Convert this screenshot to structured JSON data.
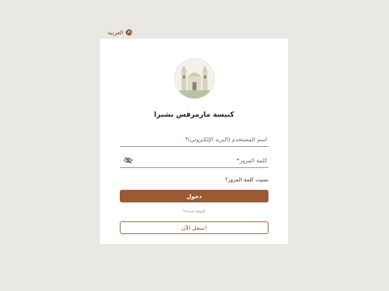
{
  "language_switch": {
    "label": "العربية",
    "icon": "globe-icon"
  },
  "logo": {
    "icon": "church-icon"
  },
  "title": "كنيسة مارمرقس بشبرا",
  "username_field": {
    "label": "اسم المستخدم (البريد الإلكتروني)",
    "required_mark": "*"
  },
  "password_field": {
    "label": "كلمة المرور",
    "required_mark": "*",
    "toggle_icon": "eye-off-icon"
  },
  "forgot_password": "نسيت كلمة المرور؟",
  "login_button": "دخول",
  "new_church_text": "كنيسة جديدة؟",
  "register_button": "سجل الآن!",
  "colors": {
    "accent": "#9a5a34",
    "background": "#e9e8e3",
    "required": "#c62828"
  }
}
